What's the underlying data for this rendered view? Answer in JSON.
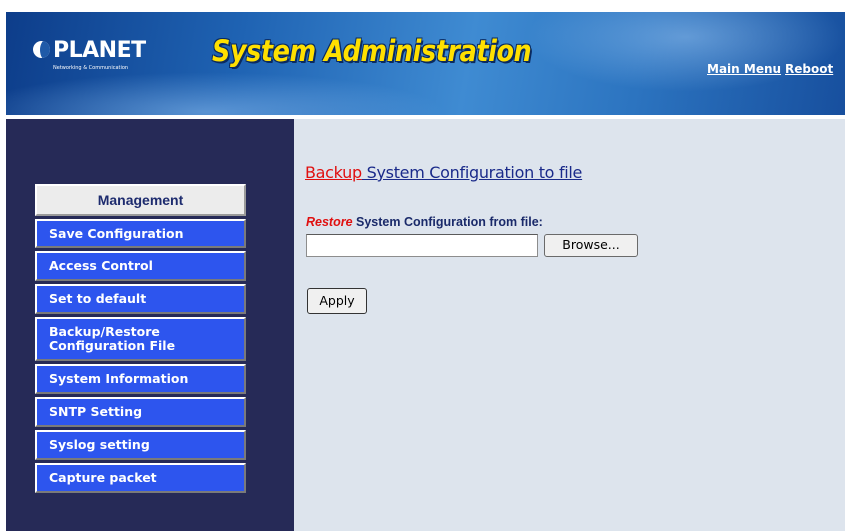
{
  "header": {
    "logo_text": "PLANET",
    "logo_subtext": "Networking & Communication",
    "title": "System Administration",
    "nav": [
      {
        "label": "Main Menu"
      },
      {
        "label": "Reboot"
      }
    ]
  },
  "sidebar": {
    "header": "Management",
    "items": [
      {
        "label": "Save Configuration"
      },
      {
        "label": "Access Control"
      },
      {
        "label": "Set to default"
      },
      {
        "label": "Backup/Restore Configuration File"
      },
      {
        "label": "System Information"
      },
      {
        "label": "SNTP Setting"
      },
      {
        "label": "Syslog setting"
      },
      {
        "label": "Capture packet"
      }
    ]
  },
  "main": {
    "backup_link": "Backup",
    "backup_rest": " System Configuration to file",
    "restore_label": "Restore",
    "restore_rest": " System Configuration from file:",
    "file_value": "",
    "browse_label": "Browse...",
    "apply_label": "Apply"
  },
  "colors": {
    "sidebar_bg": "#262a57",
    "menu_item_bg": "#2d55ee",
    "content_bg": "#dde4ed",
    "title_yellow": "#ffe000",
    "highlight_red": "#e01010"
  }
}
